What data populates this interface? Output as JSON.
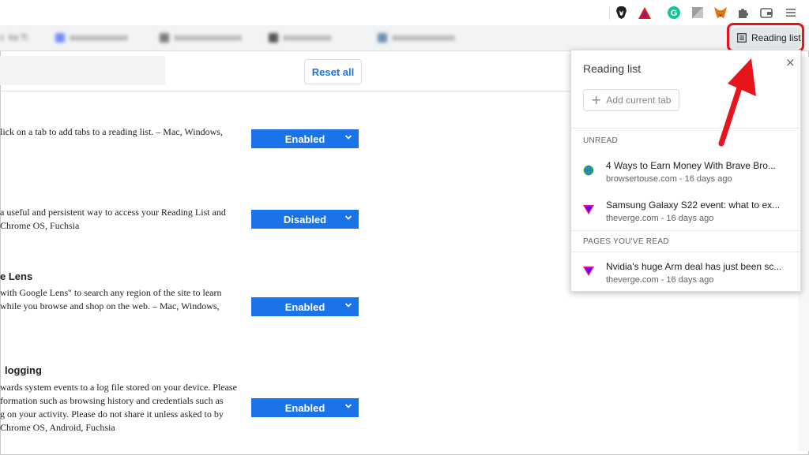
{
  "toolbar": {
    "extensions": [
      {
        "name": "brave-lion-icon"
      },
      {
        "name": "brave-rewards-icon"
      },
      {
        "name": "grammarly-icon"
      },
      {
        "name": "extension-gray-icon"
      },
      {
        "name": "metamask-fox-icon"
      },
      {
        "name": "extensions-puzzle-icon"
      },
      {
        "name": "wallet-icon"
      },
      {
        "name": "menu-icon"
      }
    ]
  },
  "bookmarks": {
    "reading_list_label": "Reading list"
  },
  "flags": {
    "reset_label": "Reset all",
    "items": [
      {
        "title": "",
        "desc": [
          "lick on a tab to add tabs to a reading list. – Mac, Windows,"
        ],
        "value": "Enabled"
      },
      {
        "title": "",
        "desc": [
          "a useful and persistent way to access your Reading List and",
          "Chrome OS, Fuchsia"
        ],
        "value": "Disabled"
      },
      {
        "title": "e Lens",
        "desc": [
          "with Google Lens\" to search any region of the site to learn",
          "while you browse and shop on the web. – Mac, Windows,"
        ],
        "value": "Enabled"
      },
      {
        "title": "logging",
        "desc": [
          "wards system events to a log file stored on your device. Please",
          "formation such as browsing history and credentials such as",
          "g on your activity. Please do not share it unless asked to by",
          "Chrome OS, Android, Fuchsia"
        ],
        "value": "Enabled"
      }
    ]
  },
  "reading_list": {
    "title": "Reading list",
    "close": "×",
    "add_current_tab": "Add current tab",
    "unread_heading": "UNREAD",
    "read_heading": "PAGES YOU'VE READ",
    "unread": [
      {
        "title": "4 Ways to Earn Money With Brave Bro...",
        "source": "browsertouse.com - 16 days ago",
        "favicon": "globe-icon"
      },
      {
        "title": "Samsung Galaxy S22 event: what to ex...",
        "source": "theverge.com - 16 days ago",
        "favicon": "verge-icon"
      }
    ],
    "read": [
      {
        "title": "Nvidia's huge Arm deal has just been sc...",
        "source": "theverge.com - 16 days ago",
        "favicon": "verge-icon"
      }
    ]
  },
  "colors": {
    "accent": "#1a73e8",
    "highlight": "#e8141c"
  }
}
